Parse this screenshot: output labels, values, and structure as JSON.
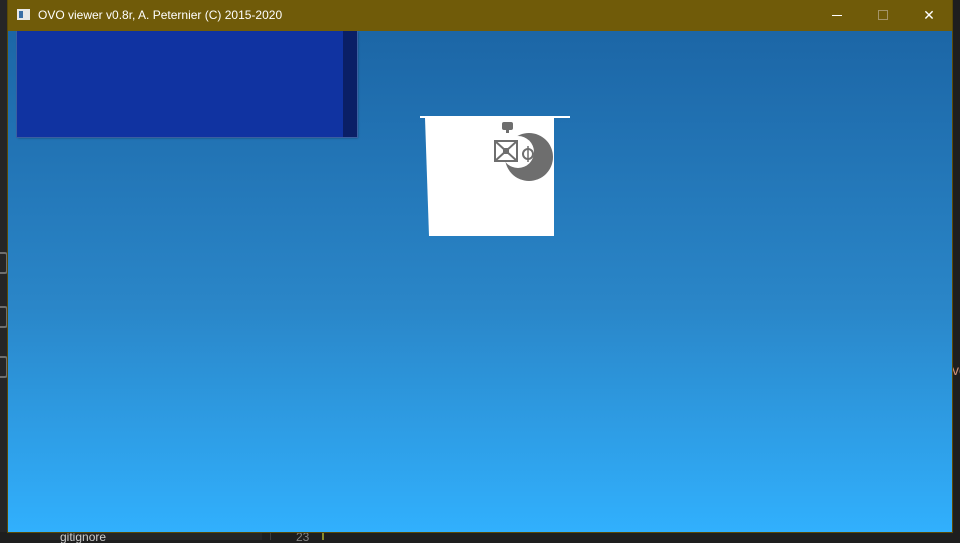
{
  "window": {
    "title": "OVO viewer v0.8r, A. Peternier (C) 2015-2020",
    "controls": {
      "minimize_icon": "minimize-icon",
      "maximize_icon": "maximize-icon",
      "close_icon": "close-icon",
      "close_glyph": "✕"
    },
    "titlebar_color": "#705b09"
  },
  "viewport": {
    "gradient_top": "#1c66a6",
    "gradient_bottom": "#31b0fd",
    "gui_panel_color": "#1033a1"
  },
  "background_editor": {
    "file_label": "gitignore",
    "line_number": "23",
    "code_fragment": "vo"
  }
}
